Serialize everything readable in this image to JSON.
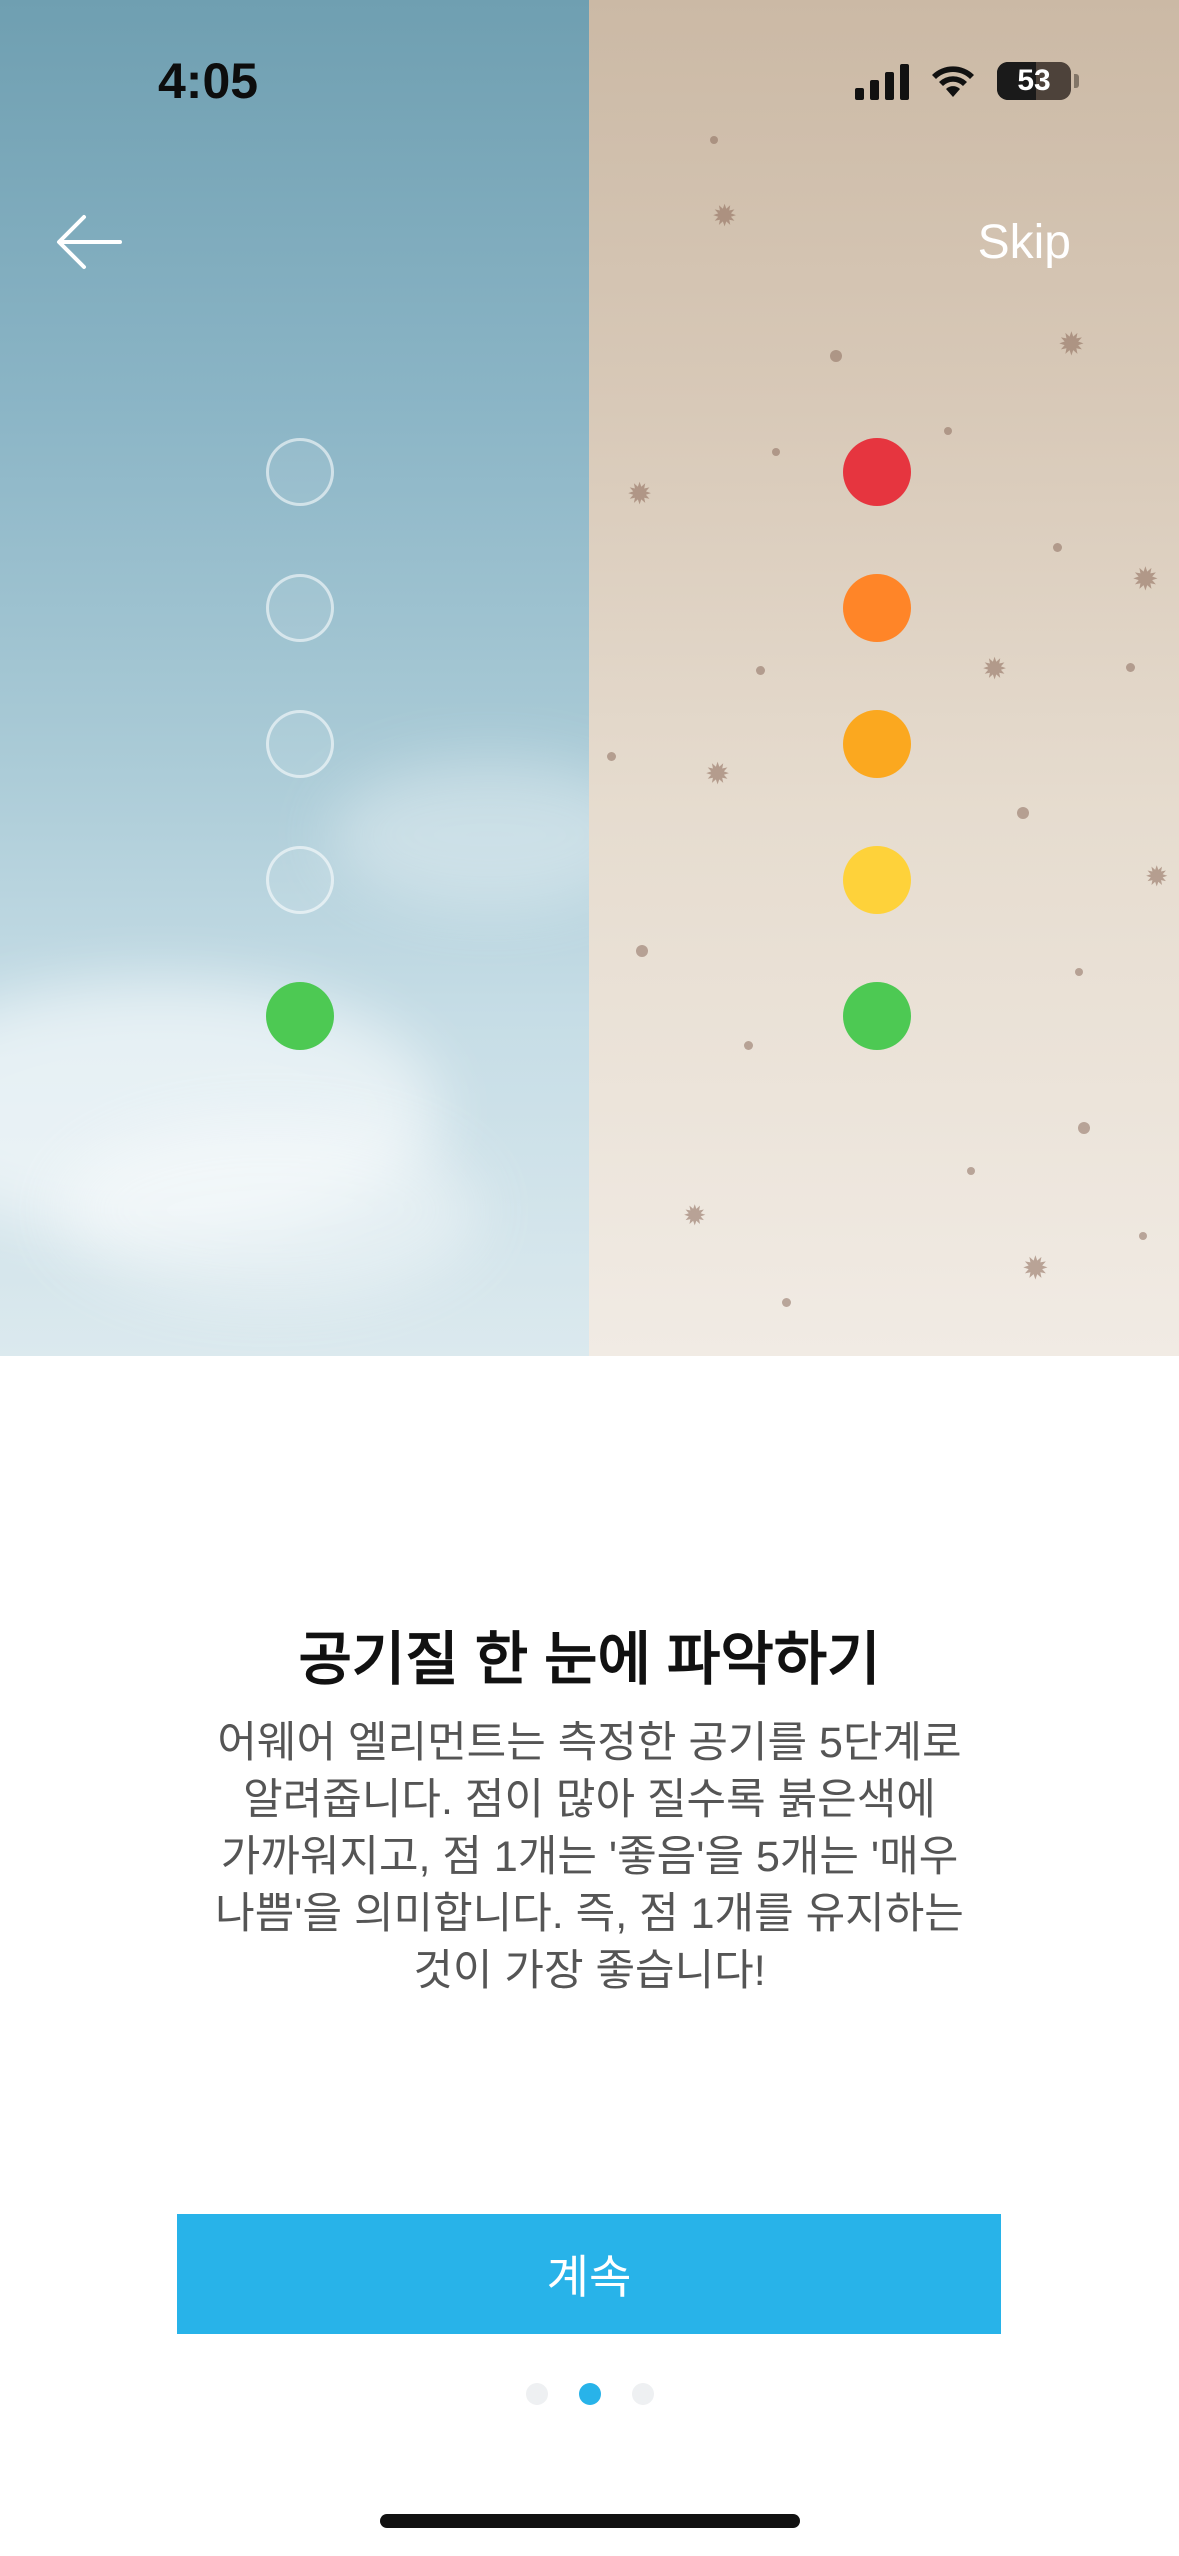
{
  "status_bar": {
    "time": "4:05",
    "battery": "53"
  },
  "nav": {
    "skip_label": "Skip"
  },
  "indicator": {
    "left_levels": [
      false,
      false,
      false,
      false,
      true
    ],
    "right_colors": [
      "#e6353f",
      "#ff8528",
      "#fba81f",
      "#fed23a",
      "#4dc953"
    ],
    "good_color": "#4dc953"
  },
  "content": {
    "title": "공기질 한 눈에 파악하기",
    "description_lines": [
      "어웨어 엘리먼트는 측정한 공기를 5단계로",
      "알려줍니다. 점이 많아 질수록 붉은색에",
      "가까워지고, 점 1개는 '좋음'을 5개는 '매우",
      "나쁨'을 의미합니다. 즉, 점 1개를 유지하는",
      "것이 가장 좋습니다!"
    ]
  },
  "actions": {
    "continue_label": "계속"
  },
  "pager": {
    "count": 3,
    "active_index": 1
  },
  "colors": {
    "accent": "#28b3e9"
  }
}
